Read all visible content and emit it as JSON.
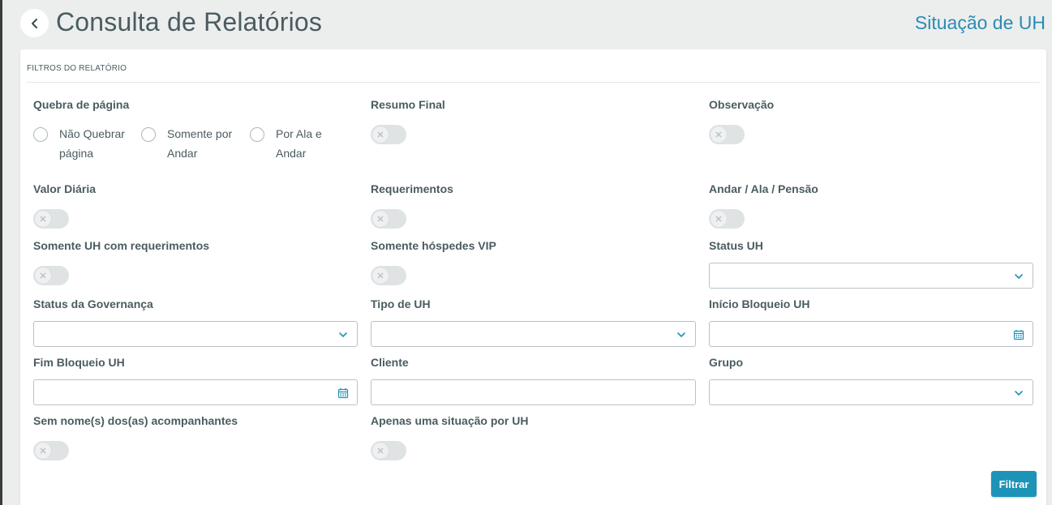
{
  "header": {
    "title": "Consulta de Relatórios",
    "report_name": "Situação de UH"
  },
  "filters": {
    "section_title": "FILTROS DO RELATÓRIO",
    "page_break": {
      "label": "Quebra de página",
      "options": [
        {
          "label": "Não Quebrar página",
          "selected": false
        },
        {
          "label": "Somente por Andar",
          "selected": false
        },
        {
          "label": "Por Ala e Andar",
          "selected": false
        }
      ]
    },
    "toggles": {
      "resumo_final": {
        "label": "Resumo Final",
        "on": false
      },
      "observacao": {
        "label": "Observação",
        "on": false
      },
      "valor_diaria": {
        "label": "Valor Diária",
        "on": false
      },
      "requerimentos": {
        "label": "Requerimentos",
        "on": false
      },
      "andar_ala_pensao": {
        "label": "Andar / Ala / Pensão",
        "on": false
      },
      "somente_uh_req": {
        "label": "Somente UH com requerimentos",
        "on": false
      },
      "somente_vip": {
        "label": "Somente hóspedes VIP",
        "on": false
      },
      "sem_nomes": {
        "label": "Sem nome(s) dos(as) acompanhantes",
        "on": false
      },
      "uma_situacao": {
        "label": "Apenas uma situação por UH",
        "on": false
      }
    },
    "fields": {
      "status_uh": {
        "label": "Status UH",
        "value": ""
      },
      "status_governanca": {
        "label": "Status da Governança",
        "value": ""
      },
      "tipo_uh": {
        "label": "Tipo de UH",
        "value": ""
      },
      "inicio_bloqueio": {
        "label": "Início Bloqueio UH",
        "value": ""
      },
      "fim_bloqueio": {
        "label": "Fim Bloqueio UH",
        "value": ""
      },
      "cliente": {
        "label": "Cliente",
        "value": ""
      },
      "grupo": {
        "label": "Grupo",
        "value": ""
      }
    },
    "filter_button": "Filtrar"
  },
  "colors": {
    "accent": "#1e93b8",
    "title": "#4a5c60",
    "report_name": "#2a8cb3"
  }
}
